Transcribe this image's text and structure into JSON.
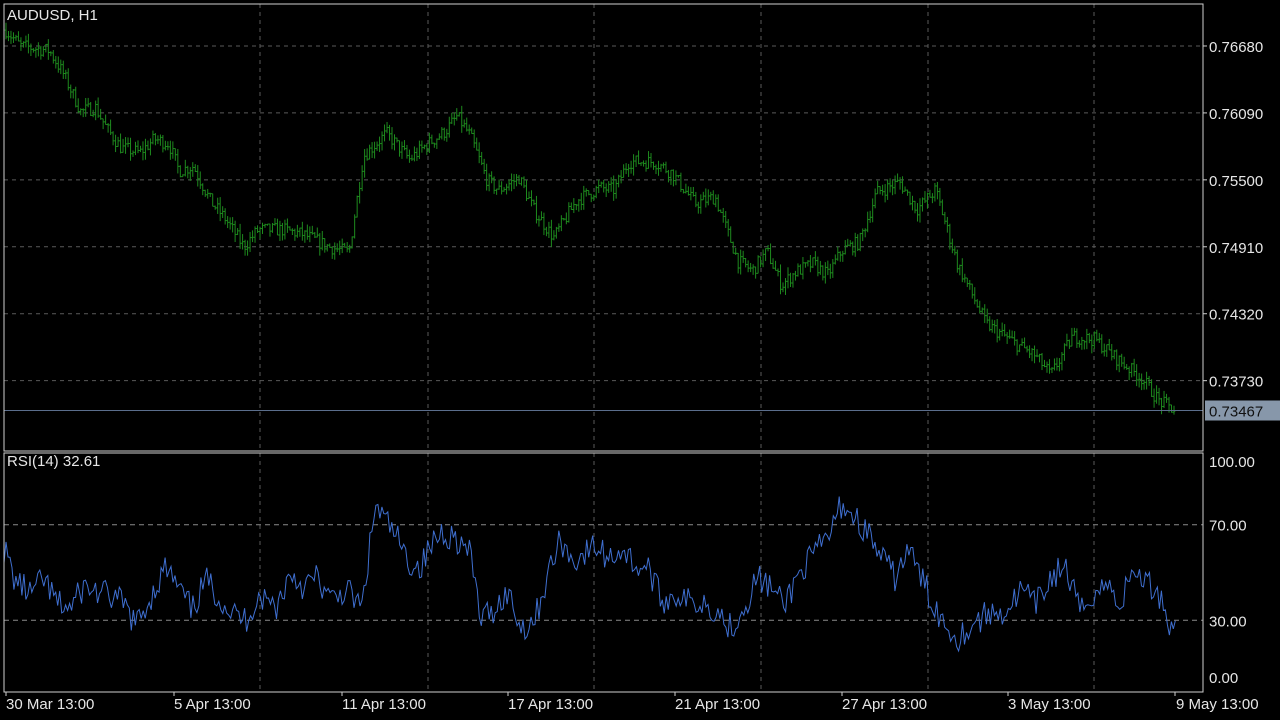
{
  "chart_title": "AUDUSD, H1",
  "indicator_title": "RSI(14) 32.61",
  "colors": {
    "background": "#000000",
    "grid": "#5a5a5a",
    "frame": "#cfcfcf",
    "bars": "#1e8a1e",
    "rsi_line": "#3f6fd0",
    "current_price_line": "#5b6e8c",
    "current_price_label_bg": "#8797aa"
  },
  "chart_data": [
    {
      "type": "candlestick",
      "symbol": "AUDUSD",
      "timeframe": "H1",
      "title": "AUDUSD, H1",
      "ylim": [
        0.7311,
        0.7705
      ],
      "y_ticks": [
        "0.76680",
        "0.76090",
        "0.75500",
        "0.74910",
        "0.74320",
        "0.73730"
      ],
      "current_price": "0.73467",
      "x_ticks": [
        "30 Mar 13:00",
        "5 Apr 13:00",
        "11 Apr 13:00",
        "17 Apr 13:00",
        "21 Apr 13:00",
        "27 Apr 13:00",
        "3 May 13:00",
        "9 May 13:00"
      ],
      "grid": true,
      "close_path": {
        "bars": 470,
        "anchors": [
          [
            0,
            0.7682
          ],
          [
            10,
            0.7668
          ],
          [
            30,
            0.7664
          ],
          [
            40,
            0.7643
          ],
          [
            52,
            0.761
          ],
          [
            62,
            0.7614
          ],
          [
            70,
            0.7595
          ],
          [
            80,
            0.7578
          ],
          [
            93,
            0.7574
          ],
          [
            103,
            0.7586
          ],
          [
            113,
            0.7582
          ],
          [
            120,
            0.7558
          ],
          [
            130,
            0.7562
          ],
          [
            142,
            0.7531
          ],
          [
            152,
            0.7516
          ],
          [
            165,
            0.7491
          ],
          [
            175,
            0.7506
          ],
          [
            192,
            0.7506
          ],
          [
            206,
            0.7502
          ],
          [
            224,
            0.7491
          ],
          [
            238,
            0.7486
          ],
          [
            248,
            0.7571
          ],
          [
            264,
            0.7591
          ],
          [
            280,
            0.7568
          ],
          [
            292,
            0.7581
          ],
          [
            305,
            0.7593
          ],
          [
            313,
            0.7606
          ],
          [
            322,
            0.7589
          ],
          [
            334,
            0.7549
          ],
          [
            342,
            0.7541
          ],
          [
            356,
            0.7552
          ],
          [
            366,
            0.7524
          ],
          [
            380,
            0.7499
          ],
          [
            396,
            0.7532
          ],
          [
            412,
            0.7543
          ],
          [
            422,
            0.7541
          ],
          [
            432,
            0.7566
          ],
          [
            450,
            0.7566
          ],
          [
            462,
            0.7556
          ],
          [
            478,
            0.7529
          ],
          [
            492,
            0.7535
          ],
          [
            498,
            0.7513
          ],
          [
            508,
            0.7478
          ],
          [
            518,
            0.747
          ],
          [
            528,
            0.7487
          ],
          [
            538,
            0.7457
          ],
          [
            548,
            0.7469
          ],
          [
            560,
            0.7476
          ],
          [
            570,
            0.7466
          ],
          [
            580,
            0.7488
          ],
          [
            592,
            0.7495
          ],
          [
            604,
            0.7539
          ],
          [
            620,
            0.7548
          ],
          [
            632,
            0.7524
          ],
          [
            645,
            0.7541
          ],
          [
            660,
            0.7476
          ],
          [
            680,
            0.7423
          ],
          [
            700,
            0.7406
          ],
          [
            714,
            0.7395
          ],
          [
            725,
            0.7378
          ],
          [
            740,
            0.7412
          ],
          [
            756,
            0.7409
          ],
          [
            768,
            0.7395
          ],
          [
            778,
            0.7385
          ],
          [
            788,
            0.7375
          ],
          [
            800,
            0.7355
          ],
          [
            812,
            0.7346
          ]
        ]
      }
    },
    {
      "type": "line",
      "title": "RSI(14) 32.61",
      "series": [
        {
          "name": "RSI(14)",
          "last_value": 32.61
        }
      ],
      "ylim": [
        0,
        100
      ],
      "y_ticks": [
        "100.00",
        "70.00",
        "30.00",
        "0.00"
      ],
      "levels": [
        70,
        30
      ],
      "x_ticks": [
        "30 Mar 13:00",
        "5 Apr 13:00",
        "11 Apr 13:00",
        "17 Apr 13:00",
        "21 Apr 13:00",
        "27 Apr 13:00",
        "3 May 13:00",
        "9 May 13:00"
      ],
      "grid": true,
      "anchors": [
        [
          0,
          60
        ],
        [
          8,
          47
        ],
        [
          20,
          41
        ],
        [
          30,
          47
        ],
        [
          40,
          37
        ],
        [
          50,
          35
        ],
        [
          60,
          44
        ],
        [
          70,
          42
        ],
        [
          80,
          40
        ],
        [
          90,
          37
        ],
        [
          100,
          28
        ],
        [
          110,
          39
        ],
        [
          122,
          52
        ],
        [
          132,
          43
        ],
        [
          142,
          34
        ],
        [
          152,
          47
        ],
        [
          162,
          40
        ],
        [
          172,
          33
        ],
        [
          182,
          30
        ],
        [
          192,
          40
        ],
        [
          206,
          36
        ],
        [
          216,
          50
        ],
        [
          226,
          44
        ],
        [
          236,
          48
        ],
        [
          246,
          38
        ],
        [
          258,
          43
        ],
        [
          270,
          35
        ],
        [
          280,
          78
        ],
        [
          286,
          73
        ],
        [
          296,
          65
        ],
        [
          304,
          55
        ],
        [
          314,
          52
        ],
        [
          322,
          61
        ],
        [
          330,
          67
        ],
        [
          340,
          65
        ],
        [
          352,
          57
        ],
        [
          360,
          30
        ],
        [
          370,
          35
        ],
        [
          380,
          42
        ],
        [
          390,
          27
        ],
        [
          400,
          30
        ],
        [
          412,
          52
        ],
        [
          420,
          64
        ],
        [
          428,
          55
        ],
        [
          436,
          57
        ],
        [
          446,
          61
        ],
        [
          456,
          56
        ],
        [
          466,
          60
        ],
        [
          476,
          53
        ],
        [
          486,
          52
        ],
        [
          496,
          38
        ],
        [
          508,
          41
        ],
        [
          518,
          37
        ],
        [
          528,
          38
        ],
        [
          538,
          34
        ],
        [
          548,
          27
        ],
        [
          558,
          35
        ],
        [
          568,
          48
        ],
        [
          578,
          44
        ],
        [
          588,
          36
        ],
        [
          600,
          50
        ],
        [
          612,
          58
        ],
        [
          622,
          65
        ],
        [
          632,
          79
        ],
        [
          642,
          73
        ],
        [
          652,
          66
        ],
        [
          662,
          56
        ],
        [
          672,
          48
        ],
        [
          682,
          60
        ],
        [
          690,
          50
        ],
        [
          700,
          38
        ],
        [
          710,
          28
        ],
        [
          720,
          23
        ],
        [
          730,
          28
        ],
        [
          740,
          32
        ],
        [
          756,
          34
        ],
        [
          768,
          43
        ],
        [
          778,
          36
        ],
        [
          790,
          48
        ],
        [
          800,
          53
        ],
        [
          812,
          33
        ],
        [
          822,
          42
        ],
        [
          832,
          45
        ],
        [
          842,
          37
        ],
        [
          852,
          51
        ],
        [
          862,
          46
        ],
        [
          874,
          39
        ],
        [
          880,
          25
        ],
        [
          884,
          33
        ]
      ]
    }
  ]
}
